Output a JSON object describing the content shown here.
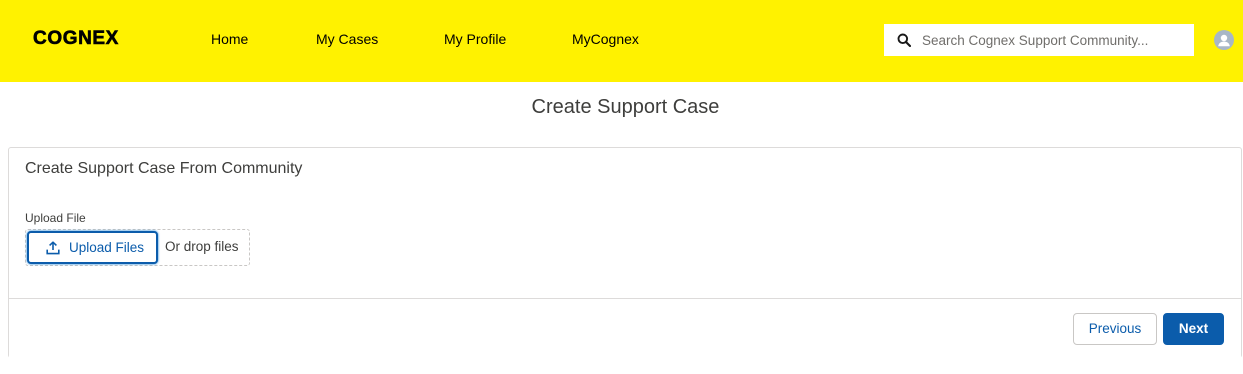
{
  "header": {
    "logo_text": "COGNEX",
    "background_color": "#fff200",
    "nav": [
      {
        "label": "Home"
      },
      {
        "label": "My Cases"
      },
      {
        "label": "My Profile"
      },
      {
        "label": "MyCognex"
      }
    ],
    "search": {
      "placeholder": "Search Cognex Support Community...",
      "value": ""
    }
  },
  "page": {
    "title": "Create Support Case"
  },
  "card": {
    "title": "Create Support Case From Community",
    "upload": {
      "label": "Upload File",
      "button_label": "Upload Files",
      "drop_text": "Or drop files"
    },
    "footer": {
      "previous_label": "Previous",
      "next_label": "Next"
    }
  },
  "colors": {
    "brand_yellow": "#fff200",
    "primary_blue": "#0b5cab",
    "border_gray": "#dddbda"
  },
  "icons": {
    "search": "search-icon",
    "avatar": "user-avatar-icon",
    "upload": "upload-icon"
  }
}
